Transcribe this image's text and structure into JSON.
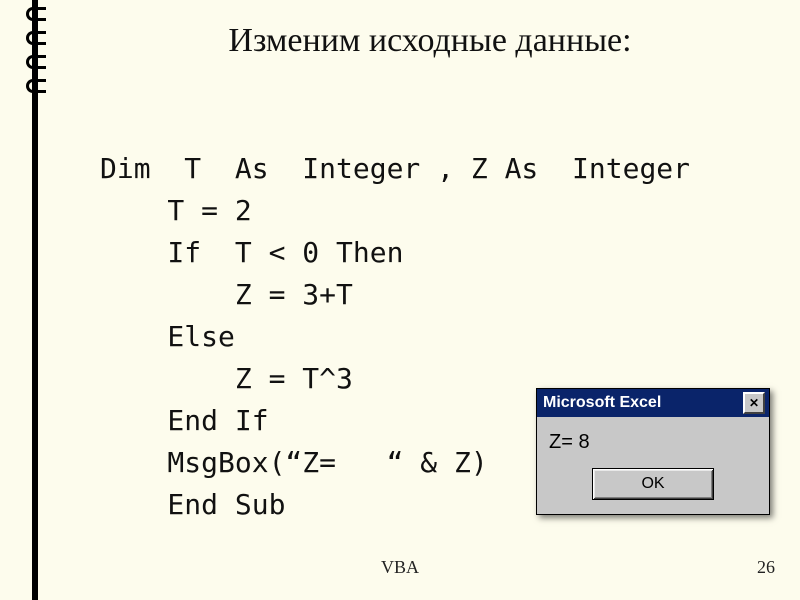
{
  "title": "Изменим исходные данные:",
  "code_lines": [
    "Dim  T  As  Integer , Z As  Integer",
    "    T = 2",
    "    If  T < 0 Then",
    "        Z = 3+T",
    "    Else",
    "        Z = T^3",
    "    End If",
    "    MsgBox(“Z=   “ & Z)",
    "    End Sub"
  ],
  "dialog": {
    "title": "Microsoft Excel",
    "close_glyph": "✕",
    "body": "Z= 8",
    "ok": "OK"
  },
  "footer": {
    "center": "VBA",
    "page": "26"
  }
}
